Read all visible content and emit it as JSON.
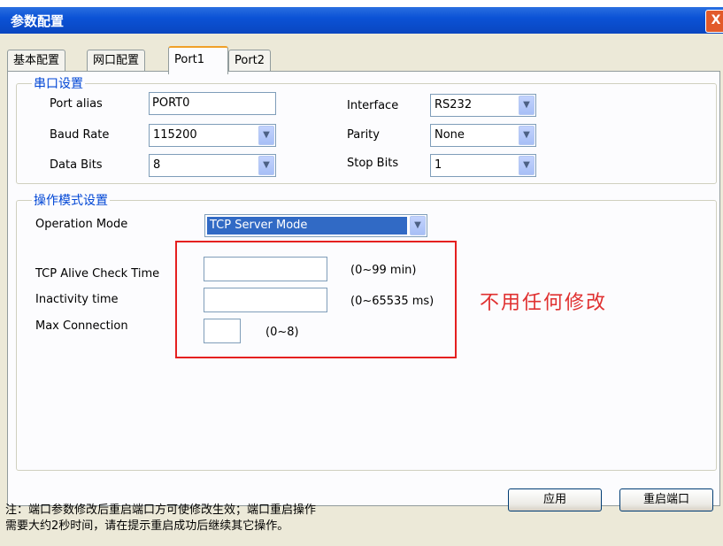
{
  "window": {
    "title": "参数配置",
    "close_glyph": "X"
  },
  "tabs": [
    {
      "label": "基本配置"
    },
    {
      "label": "网口配置"
    },
    {
      "label": "Port1"
    },
    {
      "label": "Port2"
    }
  ],
  "serial": {
    "legend": "串口设置",
    "port_alias_label": "Port alias",
    "port_alias_value": "PORT0",
    "baud_rate_label": "Baud Rate",
    "baud_rate_value": "115200",
    "data_bits_label": "Data Bits",
    "data_bits_value": "8",
    "interface_label": "Interface",
    "interface_value": "RS232",
    "parity_label": "Parity",
    "parity_value": "None",
    "stop_bits_label": "Stop Bits",
    "stop_bits_value": "1"
  },
  "mode": {
    "legend": "操作模式设置",
    "operation_mode_label": "Operation Mode",
    "operation_mode_value": "TCP Server Mode",
    "tcp_alive_label": "TCP Alive Check Time",
    "tcp_alive_value": "",
    "tcp_alive_range": "(0~99 min)",
    "inactivity_label": "Inactivity time",
    "inactivity_value": "",
    "inactivity_range": "(0~65535 ms)",
    "max_conn_label": "Max Connection",
    "max_conn_value": "",
    "max_conn_range": "(0~8)"
  },
  "annotation": {
    "text": "不用任何修改",
    "color": "#e03030"
  },
  "buttons": {
    "apply": "应用",
    "restart": "重启端口"
  },
  "footer": {
    "line1": "注：端口参数修改后重启端口方可使修改生效；端口重启操作",
    "line2": "需要大约2秒时间，请在提示重启成功后继续其它操作。"
  },
  "icons": {
    "dropdown": "chevron-down-icon"
  }
}
